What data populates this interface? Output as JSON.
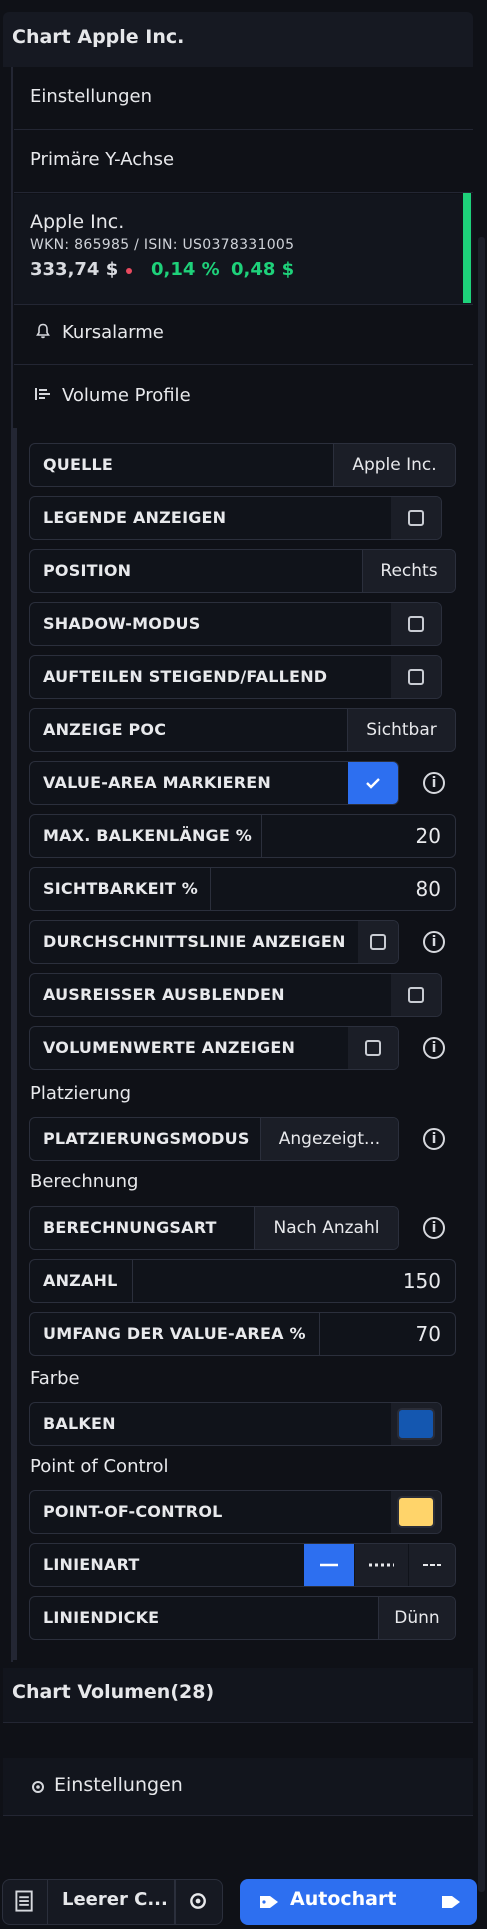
{
  "header": {
    "title": "Chart Apple Inc."
  },
  "nav": {
    "einstellungen": "Einstellungen",
    "primary_y": "Primäre Y-Achse",
    "kursalarme": "Kursalarme",
    "volume_profile": "Volume Profile"
  },
  "instrument": {
    "name": "Apple Inc.",
    "ids": "WKN: 865985 / ISIN: US0378331005",
    "price": "333,74 $",
    "change_pct": "0,14 %",
    "change_abs": "0,48 $",
    "accent_color": "#1ed17a"
  },
  "settings": {
    "quelle": {
      "label": "QUELLE",
      "value": "Apple Inc."
    },
    "legende": {
      "label": "LEGENDE ANZEIGEN",
      "checked": false
    },
    "position": {
      "label": "POSITION",
      "value": "Rechts"
    },
    "shadow": {
      "label": "SHADOW-MODUS",
      "checked": false
    },
    "aufteilen": {
      "label": "AUFTEILEN STEIGEND/FALLEND",
      "checked": false
    },
    "poc": {
      "label": "ANZEIGE POC",
      "value": "Sichtbar"
    },
    "value_area": {
      "label": "VALUE-AREA MARKIEREN",
      "checked": true,
      "info": "i"
    },
    "max_balken": {
      "label": "MAX. BALKENLÄNGE %",
      "value": "20"
    },
    "sichtbarkeit": {
      "label": "SICHTBARKEIT %",
      "value": "80"
    },
    "durchschnitt": {
      "label": "DURCHSCHNITTSLINIE ANZEIGEN",
      "checked": false,
      "info": "i"
    },
    "ausreisser": {
      "label": "AUSREISSER AUSBLENDEN",
      "checked": false
    },
    "volumenwerte": {
      "label": "VOLUMENWERTE ANZEIGEN",
      "checked": false,
      "info": "i"
    },
    "platzierung_title": "Platzierung",
    "platzierungsmodus": {
      "label": "PLATZIERUNGSMODUS",
      "value": "Angezeigt...",
      "info": "i"
    },
    "berechnung_title": "Berechnung",
    "berechnungsart": {
      "label": "BERECHNUNGSART",
      "value": "Nach Anzahl",
      "info": "i"
    },
    "anzahl": {
      "label": "ANZAHL",
      "value": "150"
    },
    "umfang": {
      "label": "UMFANG DER VALUE-AREA %",
      "value": "70"
    },
    "farbe_title": "Farbe",
    "balken": {
      "label": "BALKEN",
      "color": "#1457b0"
    },
    "poc_title": "Point of Control",
    "poc_color": {
      "label": "POINT-OF-CONTROL",
      "color": "#ffd46a"
    },
    "linienart": {
      "label": "LINIENART",
      "options": [
        "solid",
        "dotted",
        "dashed"
      ],
      "selected": "solid"
    },
    "liniendicke": {
      "label": "LINIENDICKE",
      "value": "Dünn"
    }
  },
  "footer": {
    "chart_volumen": "Chart Volumen(28)",
    "einstellungen": "Einstellungen"
  },
  "toolbar": {
    "template_label": "Leerer C...",
    "autochart_label": "Autochart",
    "accent": "#2d6ff0"
  }
}
